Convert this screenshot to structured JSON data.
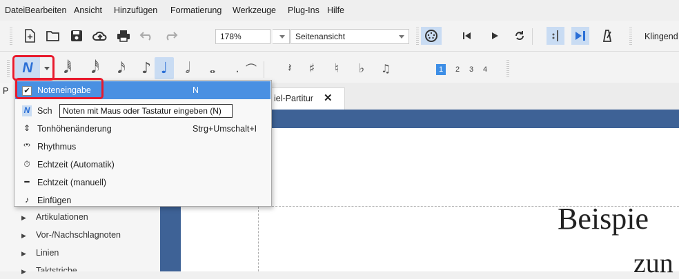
{
  "menubar": [
    "Datei",
    "Bearbeiten",
    "Ansicht",
    "Hinzufügen",
    "Formatierung",
    "Werkzeuge",
    "Plug-Ins",
    "Hilfe"
  ],
  "toolbar": {
    "zoom": "178%",
    "view_mode": "Seitenansicht",
    "playback_label": "Klingend"
  },
  "noteinput_toolbar": {
    "mode_glyph": "N",
    "voices": [
      "1",
      "2",
      "3",
      "4"
    ],
    "selected_voice": "1"
  },
  "tab": {
    "title": "iel-Partitur",
    "close": "✕"
  },
  "palette_items": [
    "Artikulationen",
    "Vor-/Nachschlagnoten",
    "Linien",
    "Taktstriche"
  ],
  "palette_partial_label": "P",
  "menu": {
    "items": [
      {
        "label": "Noteneingabe",
        "shortcut": "N",
        "icon": "check-icon"
      },
      {
        "label": "Sch",
        "shortcut": "",
        "icon": "note-input-n-icon"
      },
      {
        "label": "Tonhöhenänderung",
        "shortcut": "Strg+Umschalt+I",
        "icon": "pitch-icon"
      },
      {
        "label": "Rhythmus",
        "shortcut": "",
        "icon": "rhythm-icon"
      },
      {
        "label": "Echtzeit (Automatik)",
        "shortcut": "",
        "icon": "timer-icon"
      },
      {
        "label": "Echtzeit (manuell)",
        "shortcut": "",
        "icon": "pedal-icon"
      },
      {
        "label": "Einfügen",
        "shortcut": "",
        "icon": "insert-icon"
      }
    ]
  },
  "tooltip": "Noten mit Maus oder Tastatur eingeben (N)",
  "score": {
    "title": "Beispie",
    "subtitle": "zun"
  },
  "colors": {
    "accent": "#4a90e2",
    "highlight": "#e8192c",
    "band": "#3e6296"
  }
}
